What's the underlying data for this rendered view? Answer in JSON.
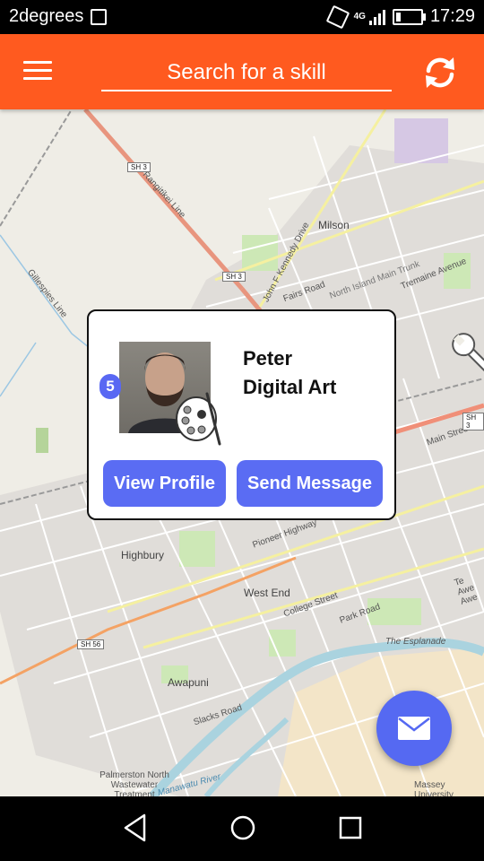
{
  "status_bar": {
    "carrier": "2degrees",
    "network": "4G",
    "time": "17:29"
  },
  "app_bar": {
    "search_placeholder": "Search for a skill",
    "color": "#FF5A1F"
  },
  "map": {
    "labels": {
      "milson": "Milson",
      "highbury": "Highbury",
      "west_end": "West End",
      "awapuni": "Awapuni",
      "rangitikei_line": "Rangitikei Line",
      "gillespies_line": "Gillespies Line",
      "kennedy_drive": "John F Kennedy Drive",
      "fairs_road": "Fairs Road",
      "pioneer_highway": "Pioneer Highway",
      "college_street": "College Street",
      "park_road": "Park Road",
      "main_street": "Main Street",
      "tremaine_avenue": "Tremaine Avenue",
      "the_esplanade": "The Esplanade",
      "manawatu_river": "Manawatu River",
      "massey": "Massey University",
      "palmerston": "Palmerston North Wastewater Treatment",
      "slacks_road": "Slacks Road",
      "te_awe_awe": "Te Awe Awe",
      "ni_trunk": "North Island Main Trunk"
    },
    "shields": {
      "sh3_top": "SH 3",
      "sh3_mid": "SH 3",
      "sh3_right": "SH 3",
      "sh56": "SH 56"
    }
  },
  "popup": {
    "badge": "5",
    "name": "Peter",
    "skill": "Digital Art",
    "skill_icon": "palette-icon",
    "view_profile": "View Profile",
    "send_message": "Send Message",
    "button_color": "#5A6CF3"
  },
  "fab": {
    "icon": "envelope-icon",
    "color": "#5569F2"
  }
}
